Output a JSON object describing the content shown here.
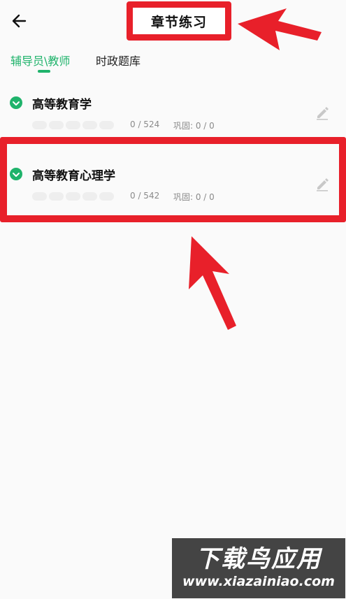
{
  "header": {
    "title": "章节练习",
    "back_icon": "arrow-left-icon"
  },
  "tabs": [
    {
      "label": "辅导员\\教师",
      "active": true
    },
    {
      "label": "时政题库",
      "active": false
    }
  ],
  "items": [
    {
      "title": "高等教育学",
      "count": "0 / 524",
      "review": "巩固: 0 / 0"
    },
    {
      "title": "高等教育心理学",
      "count": "0 / 542",
      "review": "巩固: 0 / 0"
    }
  ],
  "watermark": {
    "text": "下载鸟应用",
    "url": "www.xiazainiao.com"
  },
  "colors": {
    "accent": "#1fb36b",
    "annotation": "#e8202a",
    "progress_bg": "#eeeeee",
    "muted": "#8a8a8a"
  }
}
